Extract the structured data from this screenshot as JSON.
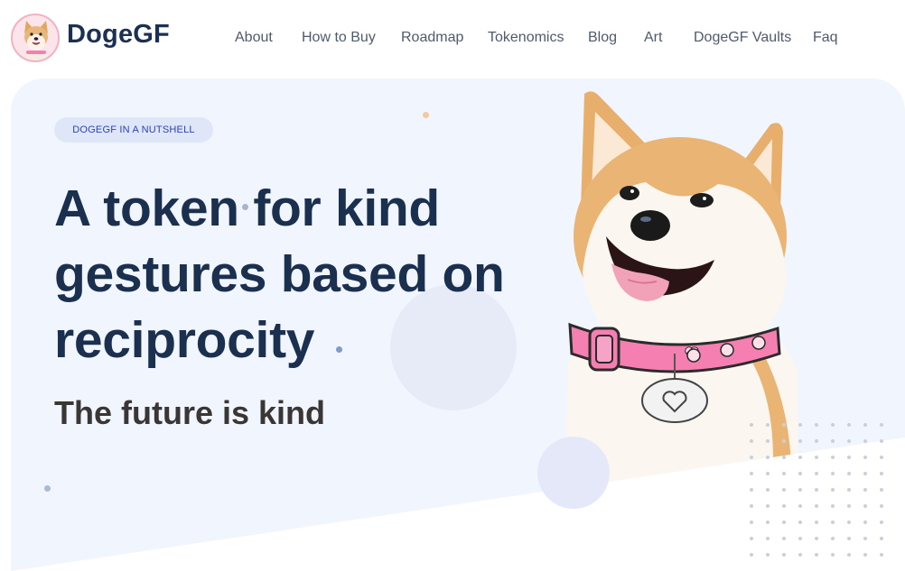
{
  "brand": {
    "name": "DogeGF",
    "logo_icon": "shiba-dog-avatar-icon"
  },
  "nav": {
    "items": [
      {
        "label": "About"
      },
      {
        "label": "How to Buy"
      },
      {
        "label": "Roadmap"
      },
      {
        "label": "Tokenomics"
      },
      {
        "label": "Blog"
      },
      {
        "label": "Art"
      },
      {
        "label": "DogeGF Vaults"
      },
      {
        "label": "Faq"
      }
    ]
  },
  "hero": {
    "badge": "DOGEGF IN A NUTSHELL",
    "headline": "A token for kind gestures based on reciprocity",
    "subheadline": "The future is kind",
    "image_icon": "shiba-inu-with-pink-collar-illustration"
  },
  "colors": {
    "headline": "#1b2f4f",
    "hero_background": "#f1f5fd",
    "badge_background": "#dfe6f8",
    "badge_text": "#2a44b8",
    "collar_pink": "#f47fb0"
  }
}
